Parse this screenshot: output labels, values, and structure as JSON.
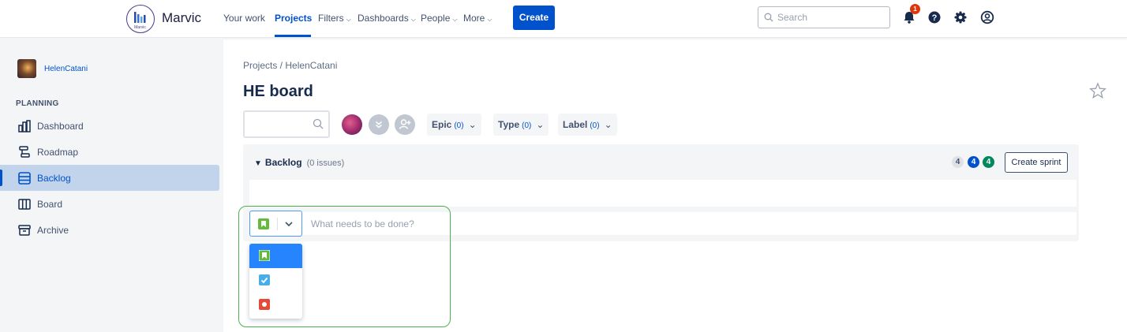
{
  "app": {
    "name": "Marvic",
    "logo_subtext": "Marvic"
  },
  "nav": {
    "items": [
      {
        "label": "Your work",
        "has_caret": false,
        "active": false
      },
      {
        "label": "Projects",
        "has_caret": false,
        "active": true
      },
      {
        "label": "Filters",
        "has_caret": true,
        "active": false
      },
      {
        "label": "Dashboards",
        "has_caret": true,
        "active": false
      },
      {
        "label": "People",
        "has_caret": true,
        "active": false
      },
      {
        "label": "More",
        "has_caret": true,
        "active": false
      }
    ],
    "create_label": "Create"
  },
  "search": {
    "placeholder": "Search"
  },
  "notifications": {
    "count": "1"
  },
  "sidebar": {
    "project_name": "HelenCatani",
    "section_label": "PLANNING",
    "items": [
      {
        "label": "Dashboard",
        "icon": "dashboard-icon",
        "active": false
      },
      {
        "label": "Roadmap",
        "icon": "roadmap-icon",
        "active": false
      },
      {
        "label": "Backlog",
        "icon": "backlog-icon",
        "active": true
      },
      {
        "label": "Board",
        "icon": "board-icon",
        "active": false
      },
      {
        "label": "Archive",
        "icon": "archive-icon",
        "active": false
      }
    ]
  },
  "main": {
    "breadcrumb": "Projects / HelenCatani",
    "title": "HE board",
    "filters": [
      {
        "label": "Epic",
        "count": "(0)"
      },
      {
        "label": "Type",
        "count": "(0)"
      },
      {
        "label": "Label",
        "count": "(0)"
      }
    ],
    "backlog": {
      "title": "Backlog",
      "issues": "(0 issues)",
      "counts": [
        "4",
        "4",
        "4"
      ],
      "create_sprint_label": "Create sprint"
    },
    "create_issue": {
      "placeholder": "What needs to be done?",
      "selected_type": "story",
      "type_options": [
        "story",
        "task",
        "bug"
      ]
    }
  },
  "colors": {
    "accent": "#0052cc",
    "story": "#63ba3c",
    "task": "#4bade8",
    "bug": "#e5493a",
    "highlight": "#4cb34c"
  }
}
